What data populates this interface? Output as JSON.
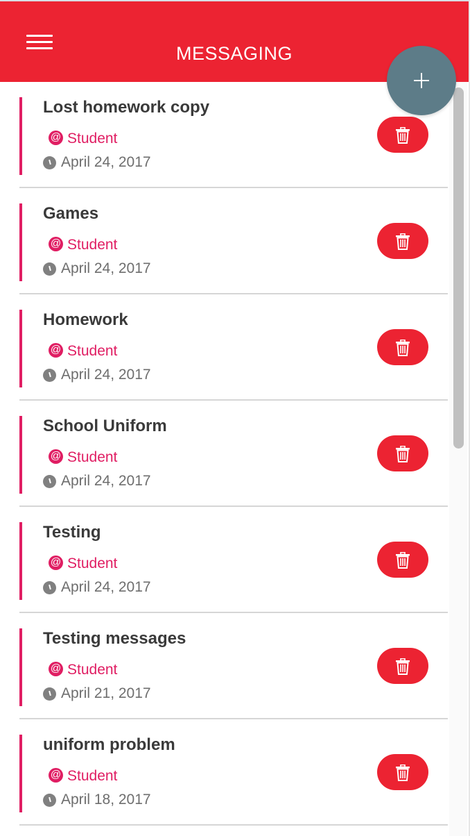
{
  "header": {
    "title": "MESSAGING",
    "menu_icon": "hamburger-menu-icon",
    "add_icon": "plus-icon",
    "colors": {
      "header_bg": "#ec2332",
      "fab_bg": "#5d7c88",
      "accent": "#e01e63"
    }
  },
  "messages": [
    {
      "title": "Lost homework copy",
      "role": "Student",
      "date": "April 24, 2017"
    },
    {
      "title": "Games",
      "role": "Student",
      "date": "April 24, 2017"
    },
    {
      "title": "Homework",
      "role": "Student",
      "date": "April 24, 2017"
    },
    {
      "title": "School Uniform",
      "role": "Student",
      "date": "April 24, 2017"
    },
    {
      "title": "Testing",
      "role": "Student",
      "date": "April 24, 2017"
    },
    {
      "title": "Testing messages",
      "role": "Student",
      "date": "April 21, 2017"
    },
    {
      "title": "uniform problem",
      "role": "Student",
      "date": "April 18, 2017"
    }
  ],
  "item_icons": {
    "role": "at-icon",
    "date": "clock-icon",
    "delete": "trash-icon"
  }
}
